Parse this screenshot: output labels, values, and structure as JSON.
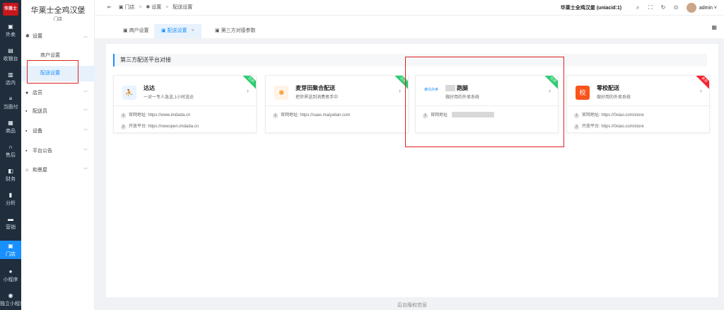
{
  "app": {
    "logo": "华莱士",
    "store_name": "华莱士全鸡汉堡",
    "store_sub": "门店"
  },
  "leftnav": [
    {
      "label": "外卖",
      "icon": "bag-icon"
    },
    {
      "label": "收银台",
      "icon": "cashier-icon"
    },
    {
      "label": "店内",
      "icon": "store-icon"
    },
    {
      "label": "当面付",
      "icon": "list-icon"
    },
    {
      "label": "商品",
      "icon": "goods-icon"
    },
    {
      "label": "售后",
      "icon": "headset-icon"
    },
    {
      "label": "财务",
      "icon": "finance-icon"
    },
    {
      "label": "分析",
      "icon": "chart-icon"
    },
    {
      "label": "营销",
      "icon": "marketing-icon"
    },
    {
      "label": "门店",
      "icon": "shop-icon"
    },
    {
      "label": "小程序",
      "icon": "miniapp-icon"
    },
    {
      "label": "独立小程序",
      "icon": "independent-miniapp-icon"
    }
  ],
  "menu": {
    "settings": "设置",
    "merchant_settings": "商户设置",
    "delivery_settings": "配送设置",
    "clerk": "店员",
    "courier": "配送员",
    "device": "设备",
    "notice": "平台公告",
    "stock": "和景屋"
  },
  "topbar": {
    "breadcrumb_store": "门店",
    "breadcrumb_settings": "设置",
    "breadcrumb_current": "配送设置",
    "sep": ">",
    "title": "华莱士全鸡汉堡 (uniacid:1)",
    "user": "admin"
  },
  "tabs": [
    {
      "label": "商户设置"
    },
    {
      "label": "配送设置"
    },
    {
      "label": "第三方对接参数"
    }
  ],
  "section": {
    "title": "第三方配送平台对接"
  },
  "cards": [
    {
      "title": "达达",
      "desc": "一对一专人急送,1小时送达",
      "ribbon": "已开",
      "ribbon_color": "#2ecc71",
      "rows": [
        {
          "n": "1",
          "text": "官网地址: https://www.imdada.cn"
        },
        {
          "n": "2",
          "text": "开放平台: https://newopen.imdada.cn"
        }
      ]
    },
    {
      "title": "麦芽田聚合配送",
      "desc": "把世界送到消费者手中",
      "ribbon": "已开",
      "ribbon_color": "#2ecc71",
      "rows": [
        {
          "n": "1",
          "text": "官网地址: https://saas.maiyatian.com"
        }
      ]
    },
    {
      "title": "跑腿",
      "desc": "做好用的外卖系统",
      "ribbon": "已开",
      "ribbon_color": "#2ecc71",
      "icon_text": "蜂鸟外卖",
      "rows": [
        {
          "n": "1",
          "text": "官网地址"
        }
      ]
    },
    {
      "title": "零校配送",
      "desc": "做好用的外卖系统",
      "ribbon": "未开",
      "ribbon_color": "#f5222d",
      "rows": [
        {
          "n": "1",
          "text": "官网地址: https://0xiao.com/store"
        },
        {
          "n": "2",
          "text": "开放平台: https://0xiao.com/store"
        }
      ]
    }
  ],
  "footer": "后台版权信息"
}
